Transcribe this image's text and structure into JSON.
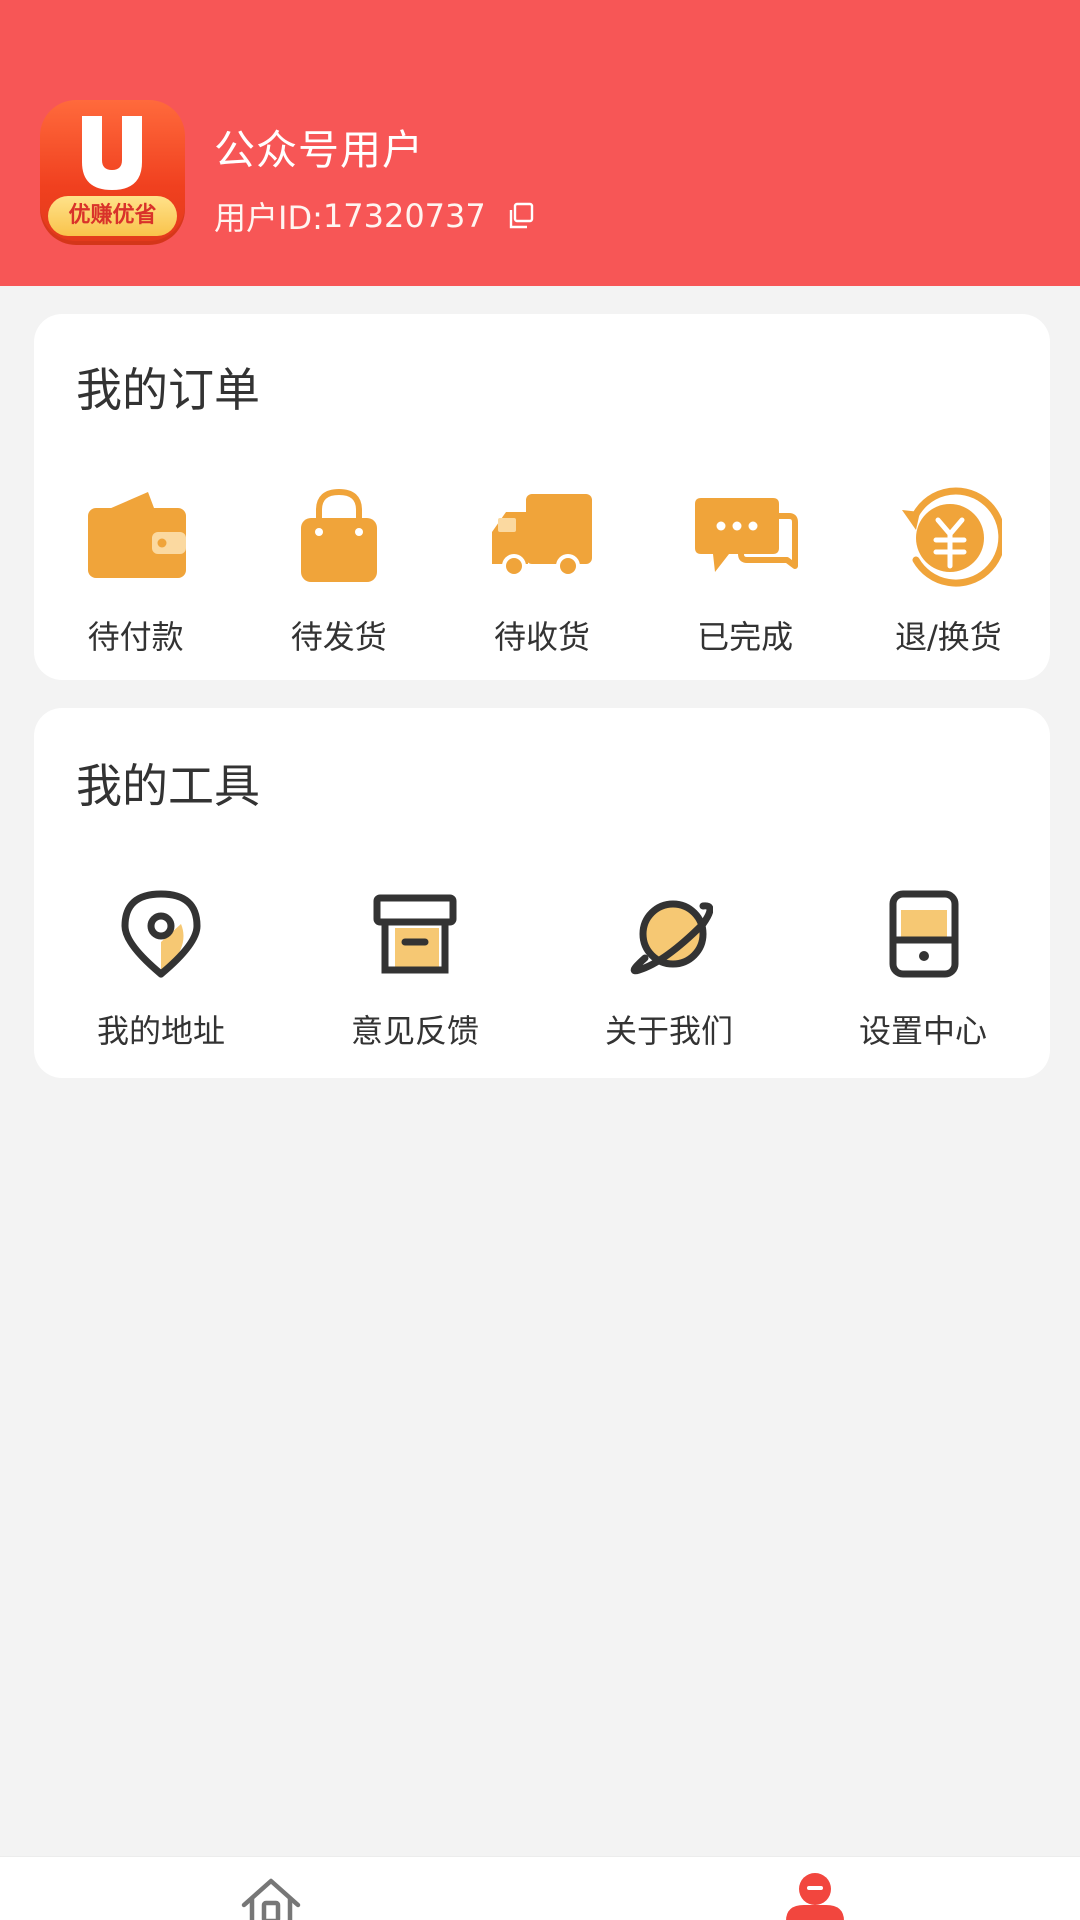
{
  "header": {
    "logo_text": "优赚优省",
    "user_name": "公众号用户",
    "user_id_label": "用户ID:",
    "user_id_value": "17320737"
  },
  "orders": {
    "title": "我的订单",
    "items": [
      {
        "label": "待付款",
        "icon": "wallet-icon"
      },
      {
        "label": "待发货",
        "icon": "shopping-bag-icon"
      },
      {
        "label": "待收货",
        "icon": "delivery-truck-icon"
      },
      {
        "label": "已完成",
        "icon": "chat-bubbles-icon"
      },
      {
        "label": "退/换货",
        "icon": "refund-yuan-icon"
      }
    ]
  },
  "tools": {
    "title": "我的工具",
    "items": [
      {
        "label": "我的地址",
        "icon": "location-pin-icon"
      },
      {
        "label": "意见反馈",
        "icon": "archive-box-icon"
      },
      {
        "label": "关于我们",
        "icon": "planet-icon"
      },
      {
        "label": "设置中心",
        "icon": "device-icon"
      }
    ]
  },
  "nav": {
    "items": [
      {
        "icon": "home-icon",
        "active": false
      },
      {
        "icon": "user-icon",
        "active": true
      }
    ]
  },
  "colors": {
    "header_bg": "#f75656",
    "accent_orange": "#f0a43a",
    "page_bg": "#f3f3f3",
    "active_nav": "#f2463e"
  }
}
